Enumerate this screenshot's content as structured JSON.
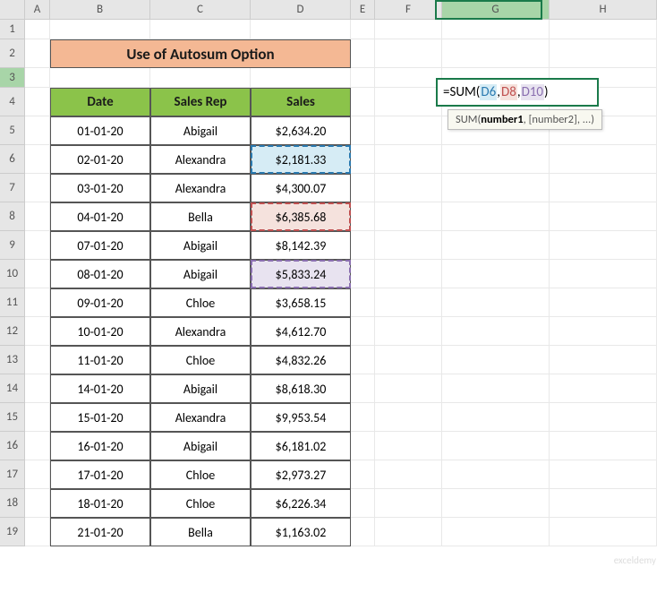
{
  "columns": [
    "A",
    "B",
    "C",
    "D",
    "E",
    "F",
    "G",
    "H"
  ],
  "rows": [
    "1",
    "2",
    "3",
    "4",
    "5",
    "6",
    "7",
    "8",
    "9",
    "10",
    "11",
    "12",
    "13",
    "14",
    "15",
    "16",
    "17",
    "18",
    "19"
  ],
  "active_col": "G",
  "active_row": "3",
  "title": "Use of Autosum Option",
  "headers": {
    "date": "Date",
    "rep": "Sales Rep",
    "sales": "Sales"
  },
  "data": [
    {
      "date": "01-01-20",
      "rep": "Abigail",
      "sales": "$2,634.20"
    },
    {
      "date": "02-01-20",
      "rep": "Alexandra",
      "sales": "$2,181.33"
    },
    {
      "date": "03-01-20",
      "rep": "Alexandra",
      "sales": "$4,300.07"
    },
    {
      "date": "04-01-20",
      "rep": "Bella",
      "sales": "$6,385.68"
    },
    {
      "date": "07-01-20",
      "rep": "Abigail",
      "sales": "$8,142.39"
    },
    {
      "date": "08-01-20",
      "rep": "Abigail",
      "sales": "$5,833.24"
    },
    {
      "date": "09-01-20",
      "rep": "Chloe",
      "sales": "$3,658.15"
    },
    {
      "date": "10-01-20",
      "rep": "Alexandra",
      "sales": "$4,612.70"
    },
    {
      "date": "11-01-20",
      "rep": "Chloe",
      "sales": "$4,832.26"
    },
    {
      "date": "14-01-20",
      "rep": "Abigail",
      "sales": "$8,618.30"
    },
    {
      "date": "15-01-20",
      "rep": "Alexandra",
      "sales": "$9,953.54"
    },
    {
      "date": "16-01-20",
      "rep": "Abigail",
      "sales": "$6,181.02"
    },
    {
      "date": "17-01-20",
      "rep": "Chloe",
      "sales": "$2,973.27"
    },
    {
      "date": "18-01-20",
      "rep": "Chloe",
      "sales": "$6,226.34"
    },
    {
      "date": "21-01-20",
      "rep": "Bella",
      "sales": "$1,163.02"
    }
  ],
  "formula": {
    "prefix": "=SUM(",
    "r1": "D6",
    "c1": ",",
    "r2": "D8",
    "c2": ",",
    "r3": "D10",
    "suffix": ")"
  },
  "tooltip": {
    "fn": "SUM(",
    "a1": "number1",
    "rest": ", [number2], ...)"
  },
  "watermark": "exceldemy"
}
